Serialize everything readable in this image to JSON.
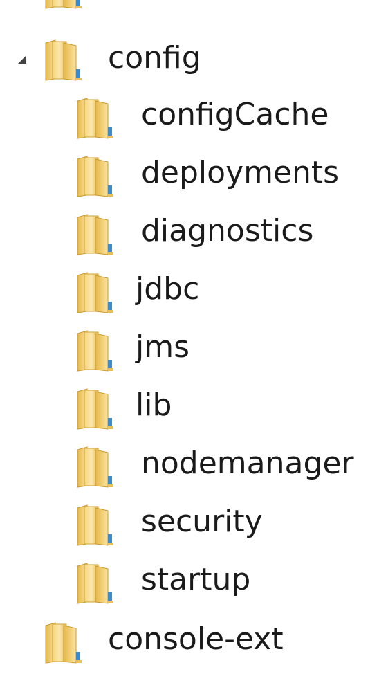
{
  "tree": {
    "root": {
      "label": "config",
      "expanded": true,
      "toggle_icon": "expanded-triangle-icon",
      "folder_icon": "folder-icon"
    },
    "children": [
      {
        "label": "configCache",
        "folder_icon": "folder-icon"
      },
      {
        "label": "deployments",
        "folder_icon": "folder-icon"
      },
      {
        "label": "diagnostics",
        "folder_icon": "folder-icon"
      },
      {
        "label": "jdbc",
        "folder_icon": "folder-icon"
      },
      {
        "label": "jms",
        "folder_icon": "folder-icon"
      },
      {
        "label": "lib",
        "folder_icon": "folder-icon"
      },
      {
        "label": "nodemanager",
        "folder_icon": "folder-icon"
      },
      {
        "label": "security",
        "folder_icon": "folder-icon"
      },
      {
        "label": "startup",
        "folder_icon": "folder-icon"
      }
    ],
    "sibling": {
      "label": "console-ext",
      "folder_icon": "folder-icon"
    }
  },
  "colors": {
    "folder_light": "#fbe6a4",
    "folder_mid": "#f2cf6a",
    "folder_dark": "#d9ab35",
    "folder_accent": "#3e89c8",
    "text": "#1a1a1a",
    "toggle": "#444444"
  }
}
